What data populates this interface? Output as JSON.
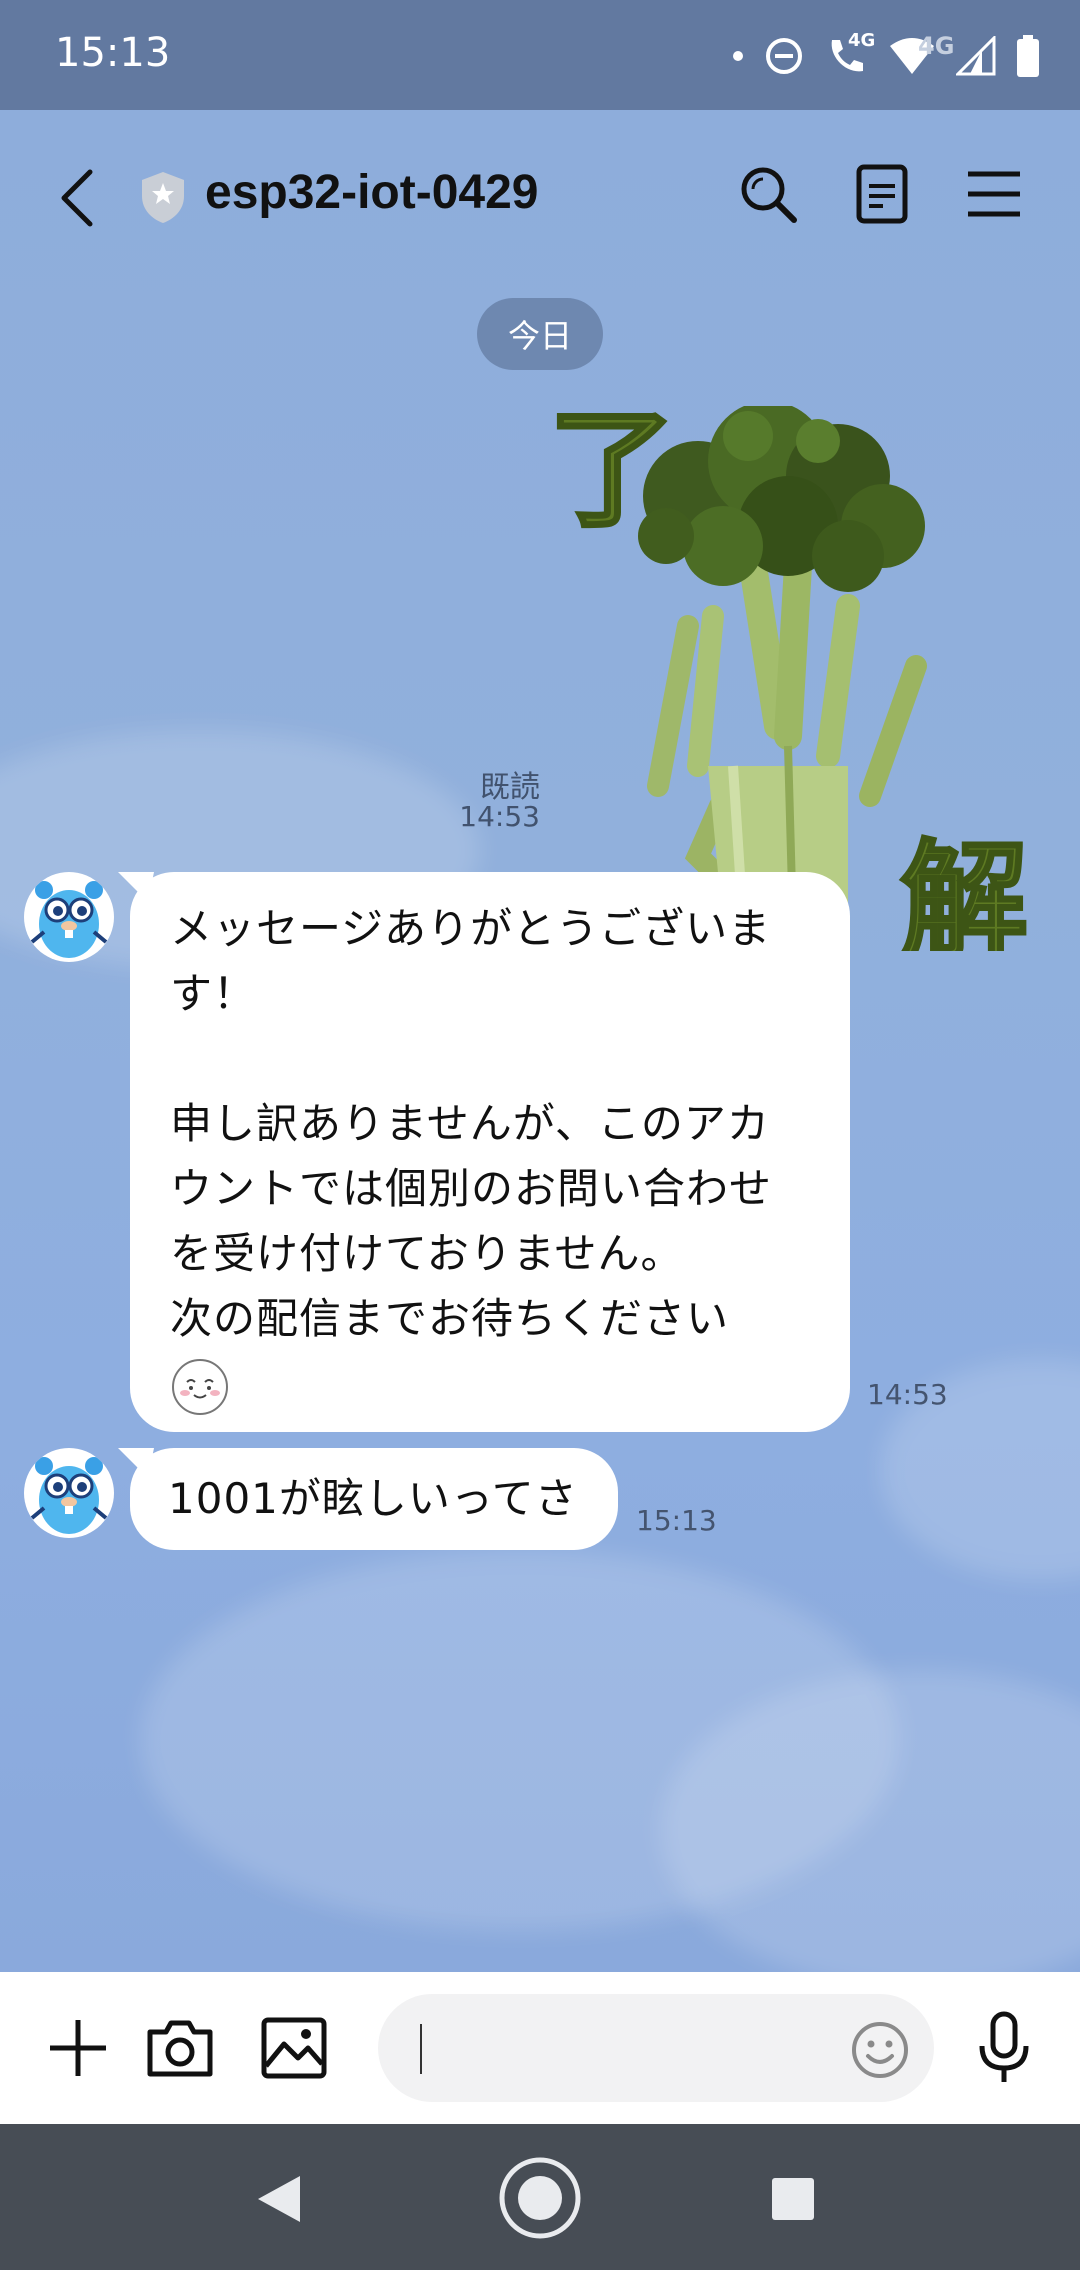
{
  "status_bar": {
    "time": "15:13",
    "icons": [
      "notification-dot-icon",
      "dnd-icon",
      "wifi-call-icon",
      "wifi-icon",
      "signal-icon",
      "battery-icon"
    ],
    "call_network": "4G",
    "network_type": "4G"
  },
  "header": {
    "title": "esp32-iot-0429",
    "icons": [
      "back-icon",
      "official-shield-icon",
      "search-icon",
      "notes-icon",
      "menu-icon"
    ]
  },
  "chat": {
    "date_separator": "今日",
    "sticker": {
      "text_top": "了",
      "text_bottom": "解",
      "read_label": "既読",
      "time": "14:53"
    },
    "messages": [
      {
        "lines": [
          "メッセージありがとうございま",
          "す！",
          "",
          "申し訳ありませんが、このアカ",
          "ウントでは個別のお問い合わせ",
          "を受け付けておりません。",
          "次の配信までお待ちください"
        ],
        "time": "14:53"
      },
      {
        "lines": [
          "1001が眩しいってさ"
        ],
        "time": "15:13"
      }
    ]
  },
  "input_bar": {
    "message_value": "",
    "icons": [
      "plus-icon",
      "camera-icon",
      "image-icon",
      "emoji-icon",
      "mic-icon"
    ]
  },
  "colors": {
    "status_bar": "#6279a0",
    "chat_background": "#8faedb",
    "bubble": "#ffffff",
    "date_pill": "#6e88b0",
    "nav_bar": "#474d55",
    "sticker_green": "#5e7a22"
  }
}
